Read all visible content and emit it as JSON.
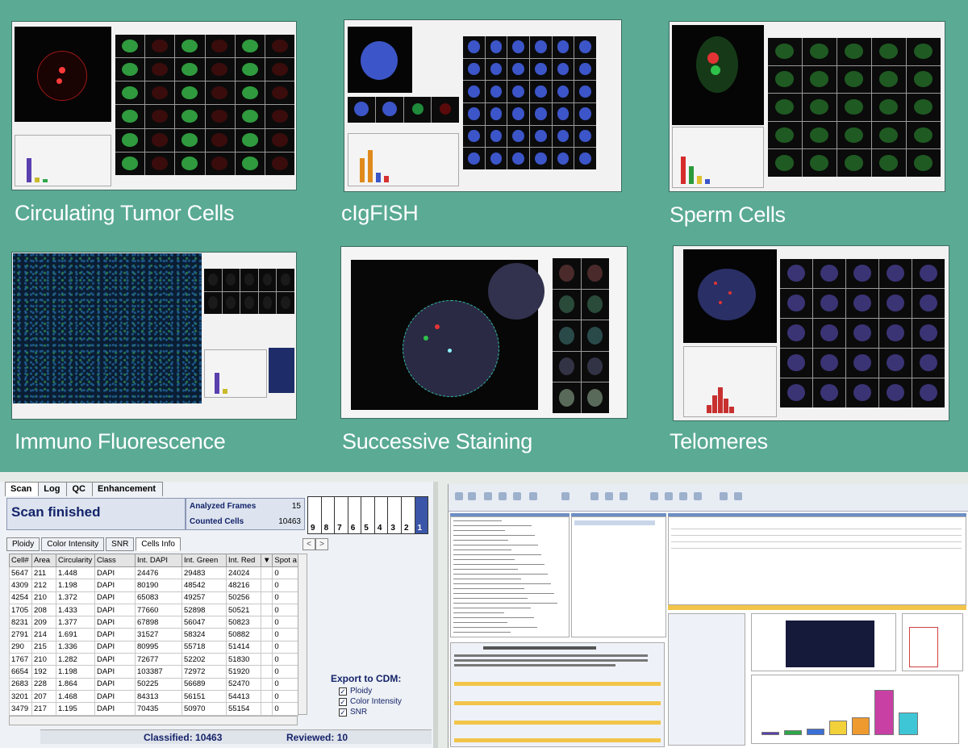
{
  "tiles": [
    {
      "id": "ctc",
      "caption": "Circulating Tumor Cells"
    },
    {
      "id": "clgfish",
      "caption": "cIgFISH"
    },
    {
      "id": "sperm",
      "caption": "Sperm Cells"
    },
    {
      "id": "immuno",
      "caption": "Immuno Fluorescence"
    },
    {
      "id": "successive",
      "caption": "Successive Staining"
    },
    {
      "id": "telomeres",
      "caption": "Telomeres"
    }
  ],
  "scan_app": {
    "tabs": [
      "Scan",
      "Log",
      "QC",
      "Enhancement"
    ],
    "status_title": "Scan finished",
    "analyzed_frames_label": "Analyzed Frames",
    "analyzed_frames_value": "15",
    "counted_cells_label": "Counted Cells",
    "counted_cells_value": "10463",
    "frame_numbers": [
      "9",
      "8",
      "7",
      "6",
      "5",
      "4",
      "3",
      "2",
      "1"
    ],
    "subtabs": [
      "Ploidy",
      "Color Intensity",
      "SNR",
      "Cells Info"
    ],
    "nav": [
      "<",
      ">"
    ],
    "columns": [
      "Cell#",
      "Area",
      "Circularity",
      "Class",
      "Int. DAPI",
      "Int. Green",
      "Int. Red",
      "",
      "Spot a"
    ],
    "rows": [
      [
        "5647",
        "211",
        "1.448",
        "DAPI",
        "24476",
        "29483",
        "24024",
        "0"
      ],
      [
        "4309",
        "212",
        "1.198",
        "DAPI",
        "80190",
        "48542",
        "48216",
        "0"
      ],
      [
        "4254",
        "210",
        "1.372",
        "DAPI",
        "65083",
        "49257",
        "50256",
        "0"
      ],
      [
        "1705",
        "208",
        "1.433",
        "DAPI",
        "77660",
        "52898",
        "50521",
        "0"
      ],
      [
        "8231",
        "209",
        "1.377",
        "DAPI",
        "67898",
        "56047",
        "50823",
        "0"
      ],
      [
        "2791",
        "214",
        "1.691",
        "DAPI",
        "31527",
        "58324",
        "50882",
        "0"
      ],
      [
        "290",
        "215",
        "1.336",
        "DAPI",
        "80995",
        "55718",
        "51414",
        "0"
      ],
      [
        "1767",
        "210",
        "1.282",
        "DAPI",
        "72677",
        "52202",
        "51830",
        "0"
      ],
      [
        "6654",
        "192",
        "1.198",
        "DAPI",
        "103387",
        "72972",
        "51920",
        "0"
      ],
      [
        "2683",
        "228",
        "1.864",
        "DAPI",
        "50225",
        "56689",
        "52470",
        "0"
      ],
      [
        "3201",
        "207",
        "1.468",
        "DAPI",
        "84313",
        "56151",
        "54413",
        "0"
      ],
      [
        "3479",
        "217",
        "1.195",
        "DAPI",
        "70435",
        "50970",
        "55154",
        "0"
      ]
    ],
    "export_title": "Export to CDM:",
    "export_options": [
      "Ploidy",
      "Color Intensity",
      "SNR"
    ],
    "classified_label": "Classified: 10463",
    "reviewed_label": "Reviewed:  10"
  },
  "colors": {
    "teal": "#5aaa94",
    "dapi": "#5576c4",
    "green": "#4ea95c",
    "red": "#d64040",
    "title_blue": "#14236a"
  }
}
